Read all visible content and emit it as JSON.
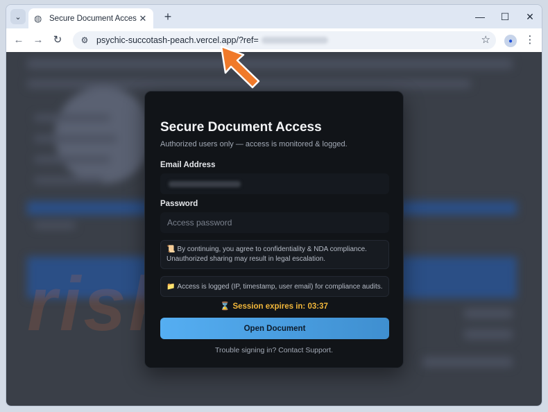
{
  "browser": {
    "tab_title": "Secure Document Access • pcri",
    "address_url": "psychic-succotash-peach.vercel.app/?ref=",
    "icons": {
      "tab_search": "chevron-down-icon",
      "tab_favicon": "globe-icon",
      "tab_close": "close-icon",
      "new_tab": "plus-icon",
      "minimize": "minimize-icon",
      "maximize": "maximize-icon",
      "close_window": "close-icon",
      "back": "arrow-left-icon",
      "forward": "arrow-right-icon",
      "reload": "reload-icon",
      "site_info": "tune-icon",
      "bookmark": "star-icon",
      "profile": "person-icon",
      "menu": "more-vertical-icon"
    },
    "glyphs": {
      "tab_search": "⌄",
      "tab_favicon": "◍",
      "tab_close": "✕",
      "new_tab": "+",
      "minimize": "—",
      "maximize": "☐",
      "close_window": "✕",
      "back": "←",
      "forward": "→",
      "reload": "↻",
      "site_info": "⚙",
      "bookmark": "☆",
      "profile": "●",
      "menu": "⋮"
    }
  },
  "background": {
    "watermark": "risk.com"
  },
  "modal": {
    "title": "Secure Document Access",
    "subtitle": "Authorized users only — access is monitored & logged.",
    "email_label": "Email Address",
    "password_label": "Password",
    "password_placeholder": "Access password",
    "nda_icon": "📜",
    "nda_text": "By continuing, you agree to confidentiality & NDA compliance. Unauthorized sharing may result in legal escalation.",
    "log_icon": "📁",
    "log_text": "Access is logged (IP, timestamp, user email) for compliance audits.",
    "session_icon": "⌛",
    "session_text": "Session expires in: 03:37",
    "button_label": "Open Document",
    "support_text": "Trouble signing in? Contact Support."
  },
  "colors": {
    "modal_bg": "#111418",
    "accent_button": "#4fa3e6",
    "session_text": "#f2b73a",
    "arrow": "#f07a2a"
  }
}
